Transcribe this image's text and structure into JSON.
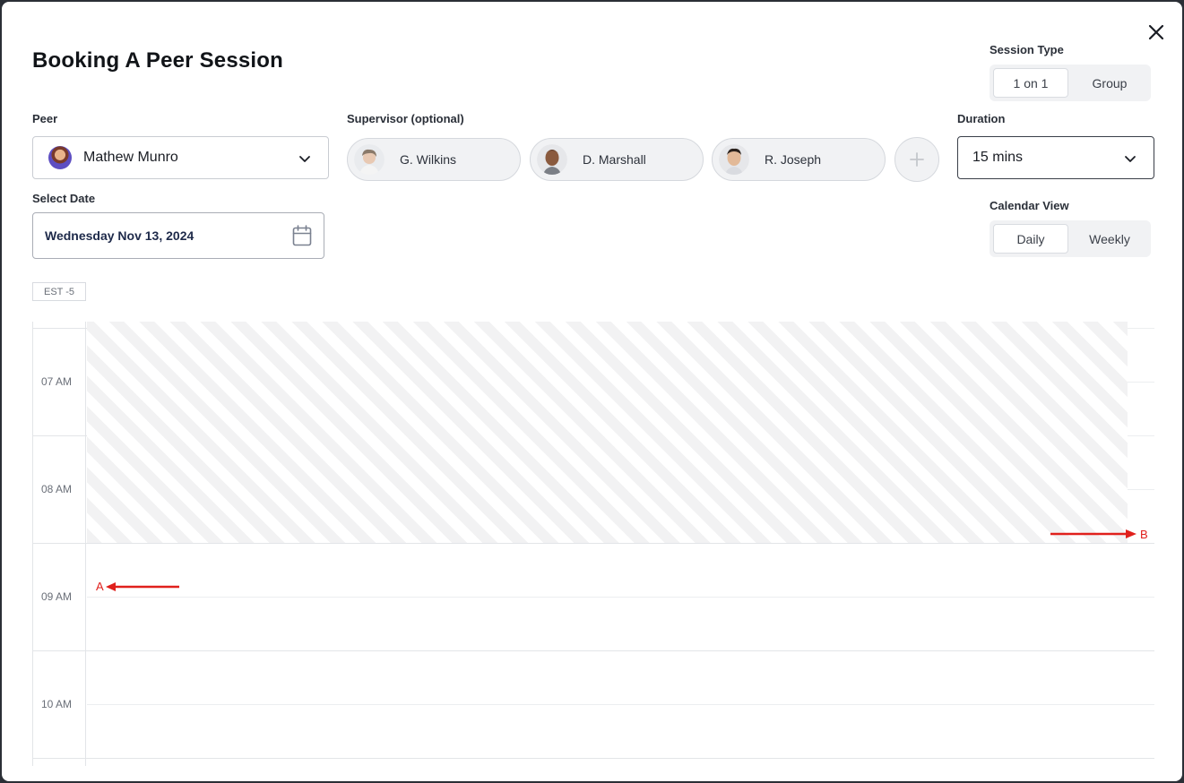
{
  "modal": {
    "title": "Booking A Peer Session",
    "close_icon": "close-icon"
  },
  "session_type": {
    "label": "Session Type",
    "options": [
      "1 on 1",
      "Group"
    ],
    "selected": "1 on 1"
  },
  "peer": {
    "label": "Peer",
    "value": "Mathew Munro"
  },
  "supervisor": {
    "label": "Supervisor (optional)",
    "chips": [
      {
        "name": "G. Wilkins"
      },
      {
        "name": "D. Marshall"
      },
      {
        "name": "R. Joseph"
      }
    ],
    "add_icon": "plus-icon"
  },
  "duration": {
    "label": "Duration",
    "value": "15 mins"
  },
  "select_date": {
    "label": "Select Date",
    "value": "Wednesday Nov 13, 2024"
  },
  "calendar_view": {
    "label": "Calendar View",
    "options": [
      "Daily",
      "Weekly"
    ],
    "selected": "Daily"
  },
  "calendar": {
    "timezone": "EST -5",
    "hours": [
      "07 AM",
      "08 AM",
      "09 AM",
      "10 AM"
    ]
  },
  "annotations": {
    "a": "A",
    "b": "B",
    "color": "#e0201c"
  }
}
